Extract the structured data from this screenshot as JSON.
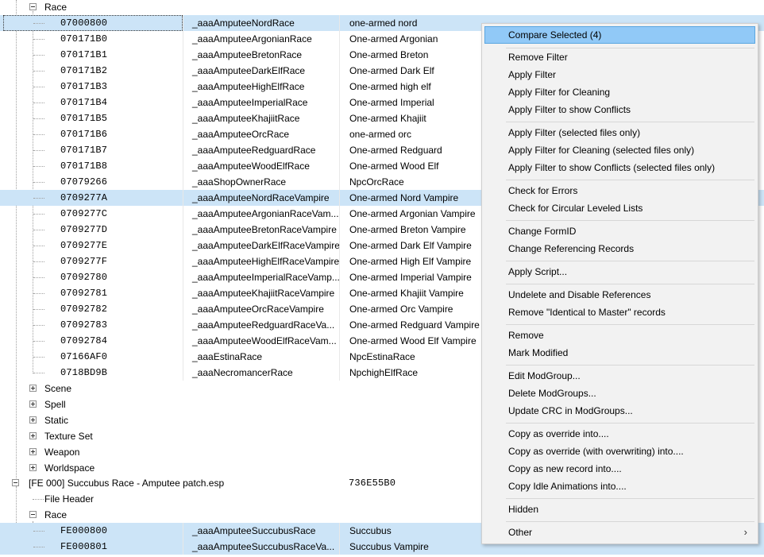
{
  "tree": {
    "race_group": "Race",
    "rows": [
      {
        "formid": "07000800",
        "edid": "_aaaAmputeeNordRace",
        "name": "one-armed nord"
      },
      {
        "formid": "070171B0",
        "edid": "_aaaAmputeeArgonianRace",
        "name": "One-armed Argonian"
      },
      {
        "formid": "070171B1",
        "edid": "_aaaAmputeeBretonRace",
        "name": "One-armed Breton"
      },
      {
        "formid": "070171B2",
        "edid": "_aaaAmputeeDarkElfRace",
        "name": "One-armed Dark Elf"
      },
      {
        "formid": "070171B3",
        "edid": "_aaaAmputeeHighElfRace",
        "name": "One-armed high elf"
      },
      {
        "formid": "070171B4",
        "edid": "_aaaAmputeeImperialRace",
        "name": "One-armed Imperial"
      },
      {
        "formid": "070171B5",
        "edid": "_aaaAmputeeKhajiitRace",
        "name": "One-armed Khajiit"
      },
      {
        "formid": "070171B6",
        "edid": "_aaaAmputeeOrcRace",
        "name": "one-armed orc"
      },
      {
        "formid": "070171B7",
        "edid": "_aaaAmputeeRedguardRace",
        "name": "One-armed Redguard"
      },
      {
        "formid": "070171B8",
        "edid": "_aaaAmputeeWoodElfRace",
        "name": "One-armed Wood Elf"
      },
      {
        "formid": "07079266",
        "edid": "_aaaShopOwnerRace",
        "name": "NpcOrcRace"
      },
      {
        "formid": "0709277A",
        "edid": "_aaaAmputeeNordRaceVampire",
        "name": "One-armed Nord Vampire"
      },
      {
        "formid": "0709277C",
        "edid": "_aaaAmputeeArgonianRaceVam...",
        "name": "One-armed Argonian Vampire"
      },
      {
        "formid": "0709277D",
        "edid": "_aaaAmputeeBretonRaceVampire",
        "name": "One-armed Breton Vampire"
      },
      {
        "formid": "0709277E",
        "edid": "_aaaAmputeeDarkElfRaceVampire",
        "name": "One-armed Dark Elf Vampire"
      },
      {
        "formid": "0709277F",
        "edid": "_aaaAmputeeHighElfRaceVampire",
        "name": "One-armed High Elf Vampire"
      },
      {
        "formid": "07092780",
        "edid": "_aaaAmputeeImperialRaceVamp...",
        "name": "One-armed Imperial Vampire"
      },
      {
        "formid": "07092781",
        "edid": "_aaaAmputeeKhajiitRaceVampire",
        "name": "One-armed Khajiit Vampire"
      },
      {
        "formid": "07092782",
        "edid": "_aaaAmputeeOrcRaceVampire",
        "name": "One-armed Orc Vampire"
      },
      {
        "formid": "07092783",
        "edid": "_aaaAmputeeRedguardRaceVa...",
        "name": "One-armed Redguard Vampire"
      },
      {
        "formid": "07092784",
        "edid": "_aaaAmputeeWoodElfRaceVam...",
        "name": "One-armed Wood Elf Vampire"
      },
      {
        "formid": "07166AF0",
        "edid": "_aaaEstinaRace",
        "name": "NpcEstinaRace"
      },
      {
        "formid": "0718BD9B",
        "edid": "_aaaNecromancerRace",
        "name": "NpchighElfRace"
      }
    ],
    "groups": [
      "Scene",
      "Spell",
      "Static",
      "Texture Set",
      "Weapon",
      "Worldspace"
    ],
    "plugin": {
      "label": "[FE 000] Succubus Race - Amputee patch.esp",
      "crc": "736E55B0"
    },
    "file_header": "File Header",
    "race2_group": "Race",
    "rows2": [
      {
        "formid": "FE000800",
        "edid": "_aaaAmputeeSuccubusRace",
        "name": "Succubus"
      },
      {
        "formid": "FE000801",
        "edid": "_aaaAmputeeSuccubusRaceVa...",
        "name": "Succubus Vampire"
      }
    ]
  },
  "menu": {
    "compare": "Compare Selected (4)",
    "remove_filter": "Remove Filter",
    "apply_filter": "Apply Filter",
    "apply_filter_cleaning": "Apply Filter for Cleaning",
    "apply_filter_conflicts": "Apply Filter to show Conflicts",
    "apply_filter_sel": "Apply Filter (selected files only)",
    "apply_filter_cleaning_sel": "Apply Filter for Cleaning (selected files only)",
    "apply_filter_conflicts_sel": "Apply Filter to show Conflicts (selected files only)",
    "check_errors": "Check for Errors",
    "check_circular": "Check for Circular Leveled Lists",
    "change_formid": "Change FormID",
    "change_refs": "Change Referencing Records",
    "apply_script": "Apply Script...",
    "undelete": "Undelete and Disable References",
    "remove_itm": "Remove \"Identical to Master\" records",
    "remove": "Remove",
    "mark_modified": "Mark Modified",
    "edit_modgroup": "Edit ModGroup...",
    "delete_modgroups": "Delete ModGroups...",
    "update_crc": "Update CRC in ModGroups...",
    "copy_override": "Copy as override into....",
    "copy_override_overwrite": "Copy as override (with overwriting) into....",
    "copy_new": "Copy as new record into....",
    "copy_idle": "Copy Idle Animations into....",
    "hidden": "Hidden",
    "other": "Other"
  }
}
